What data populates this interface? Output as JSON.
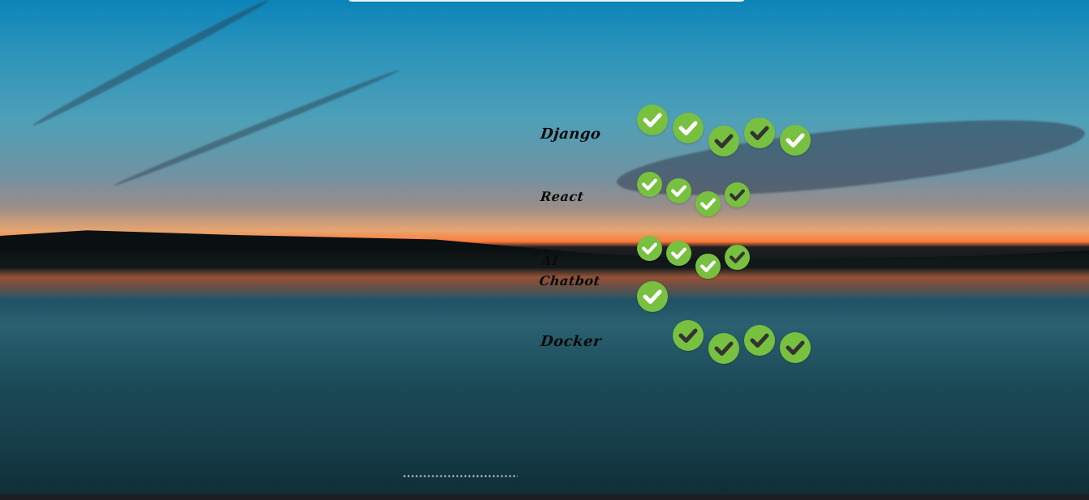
{
  "skills": [
    {
      "label": "Django",
      "checks": 5,
      "icon": "check-circle-icon"
    },
    {
      "label": "React",
      "checks": 4,
      "icon": "check-circle-icon"
    },
    {
      "label": "AI Chatbot",
      "checks": 5,
      "icon": "check-circle-icon"
    },
    {
      "label": "Docker",
      "checks": 4,
      "icon": "check-circle-icon"
    }
  ],
  "colors": {
    "check": "#78c040",
    "label": "#0a0a0a"
  }
}
